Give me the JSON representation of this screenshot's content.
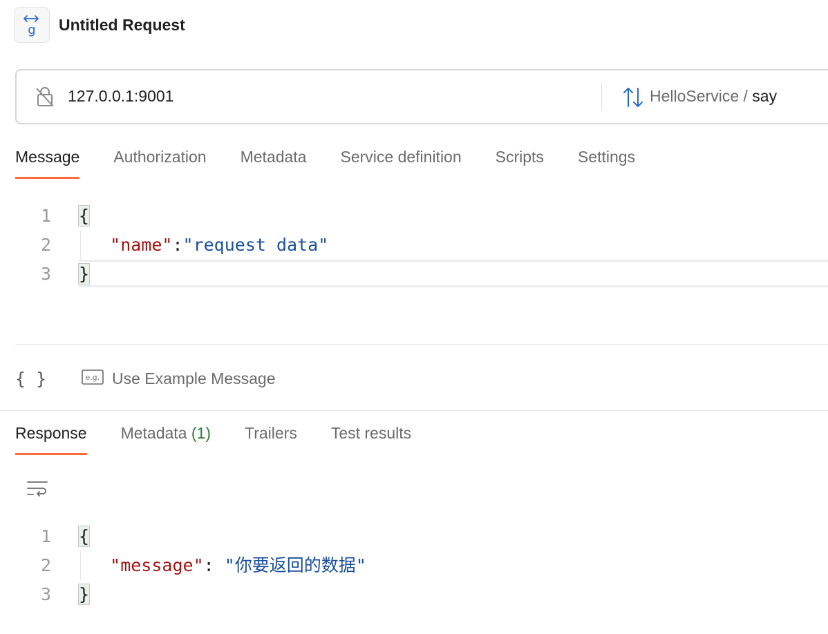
{
  "header": {
    "app_icon": "grpc-request-icon",
    "title": "Untitled Request"
  },
  "url_bar": {
    "lock_icon": "unlocked-insecure-icon",
    "url": "127.0.0.1:9001",
    "method_icon": "bidirectional-arrows-icon",
    "service": "HelloService",
    "separator": "/",
    "method": "say"
  },
  "request_tabs": [
    {
      "label": "Message",
      "active": true
    },
    {
      "label": "Authorization",
      "active": false
    },
    {
      "label": "Metadata",
      "active": false
    },
    {
      "label": "Service definition",
      "active": false
    },
    {
      "label": "Scripts",
      "active": false
    },
    {
      "label": "Settings",
      "active": false
    }
  ],
  "request_editor": {
    "line_numbers": [
      "1",
      "2",
      "3"
    ],
    "open_brace": "{",
    "indent": "   ",
    "key": "\"name\"",
    "colon": ":",
    "value": "\"request data\"",
    "close_brace": "}"
  },
  "toolbar": {
    "braces_label": "{ }",
    "example_icon": "e.g.",
    "example_label": "Use Example Message"
  },
  "response_tabs": {
    "response": "Response",
    "metadata": "Metadata",
    "metadata_count": "(1)",
    "trailers": "Trailers",
    "test_results": "Test results"
  },
  "response_editor": {
    "line_numbers": [
      "1",
      "2",
      "3"
    ],
    "open_brace": "{",
    "indent": "   ",
    "key": "\"message\"",
    "colon": ": ",
    "value_open_quote": "\"",
    "value_text": "你要返回的数据",
    "value_close_quote": "\"",
    "close_brace": "}"
  },
  "colors": {
    "accent": "#ff6c37",
    "json_key": "#a31515",
    "json_string": "#1c4f9c",
    "count": "#2f7d32"
  }
}
